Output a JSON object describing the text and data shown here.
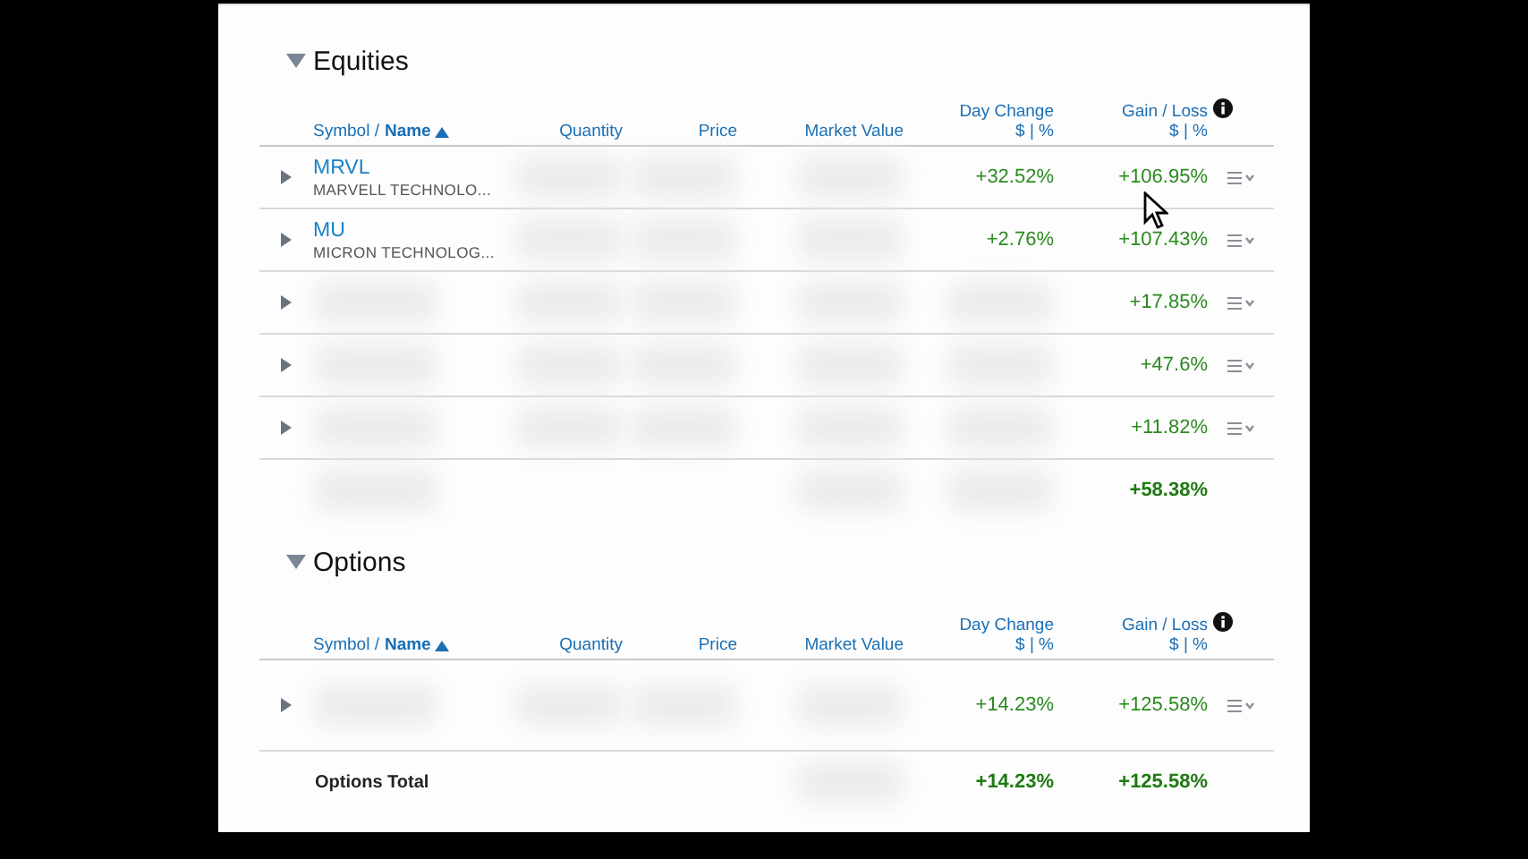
{
  "sections": [
    {
      "title": "Equities",
      "expanded": true,
      "columns": [
        {
          "label": "Symbol / **Name**",
          "sorted": true
        },
        {
          "label": "Quantity"
        },
        {
          "label": "Price"
        },
        {
          "label": "Market Value"
        },
        {
          "label": "Day Change",
          "sublabel": "$ | %"
        },
        {
          "label": "Gain / Loss",
          "sublabel": "$ | %",
          "info": true
        }
      ],
      "rows": [
        {
          "symbol": "MRVL",
          "name": "MARVELL TECHNOLO...",
          "day_change": "+32.52%",
          "gain_loss": "+106.95%"
        },
        {
          "symbol": "MU",
          "name": "MICRON TECHNOLOG...",
          "day_change": "+2.76%",
          "gain_loss": "+107.43%"
        },
        {
          "gain_loss": "+17.85%"
        },
        {
          "gain_loss": "+47.6%"
        },
        {
          "gain_loss": "+11.82%"
        }
      ],
      "total": {
        "gain_loss": "+58.38%"
      }
    },
    {
      "title": "Options",
      "expanded": true,
      "columns": [
        {
          "label": "Symbol / **Name**",
          "sorted": true
        },
        {
          "label": "Quantity"
        },
        {
          "label": "Price"
        },
        {
          "label": "Market Value"
        },
        {
          "label": "Day Change",
          "sublabel": "$ | %"
        },
        {
          "label": "Gain / Loss",
          "sublabel": "$ | %",
          "info": true
        }
      ],
      "rows": [
        {
          "day_change": "+14.23%",
          "gain_loss": "+125.58%"
        }
      ],
      "total": {
        "label": "Options Total",
        "day_change": "+14.23%",
        "gain_loss": "+125.58%"
      }
    }
  ]
}
